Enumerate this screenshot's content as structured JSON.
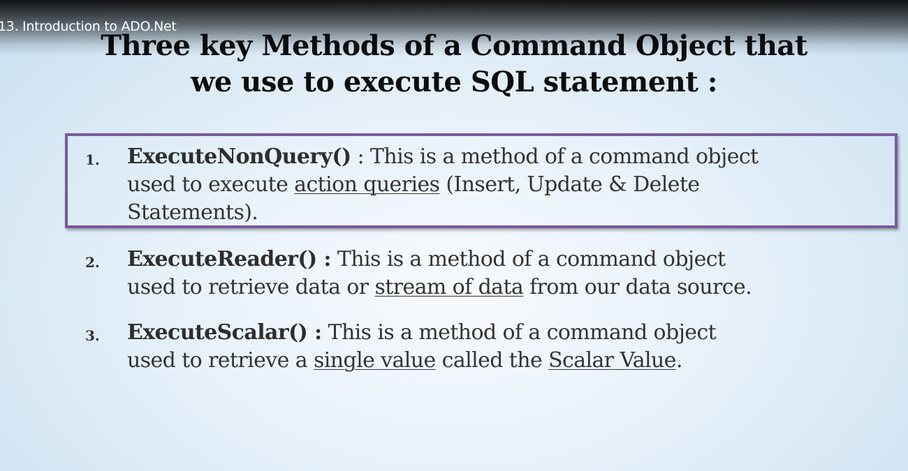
{
  "video": {
    "title": "13. Introduction to ADO.Net"
  },
  "slide": {
    "title_line1": "Three key Methods of a Command Object that",
    "title_line2": "we use to execute SQL statement :",
    "items": [
      {
        "number": "1.",
        "method": "ExecuteNonQuery()",
        "line1_rest": " : This is a method of a command object",
        "line2_pre": "used to execute ",
        "line2_link": "action queries",
        "line2_post": " (Insert, Update & Delete",
        "line3": "Statements)."
      },
      {
        "number": "2.",
        "method": "ExecuteReader() :",
        "line1_rest": " This is a method of a command object",
        "line2_pre": "used to retrieve data or ",
        "line2_link": "stream of data",
        "line2_post": " from our data source."
      },
      {
        "number": "3.",
        "method": "ExecuteScalar() :",
        "line1_rest": " This is a method of a command object",
        "line2_pre": "used to retrieve a ",
        "line2_link": "single value",
        "line2_mid": " called the ",
        "line2_link2": "Scalar Value",
        "line2_post": "."
      }
    ]
  },
  "colors": {
    "highlight_border": "#7a5a9c",
    "background": "#e9f2fa",
    "text": "#333333"
  }
}
